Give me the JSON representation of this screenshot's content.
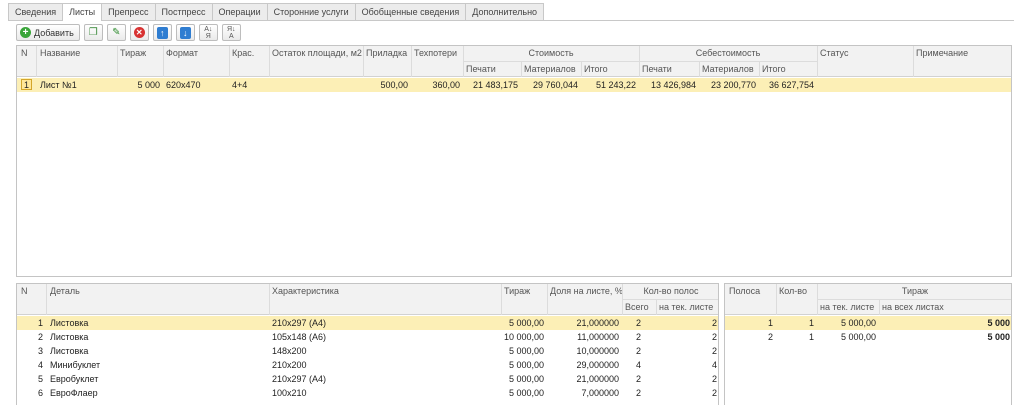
{
  "tabs": [
    {
      "label": "Сведения"
    },
    {
      "label": "Листы"
    },
    {
      "label": "Препресс"
    },
    {
      "label": "Постпресс"
    },
    {
      "label": "Операции"
    },
    {
      "label": "Сторонние услуги"
    },
    {
      "label": "Обобщенные сведения"
    },
    {
      "label": "Дополнительно"
    }
  ],
  "toolbar": {
    "add_label": "Добавить"
  },
  "sheets": {
    "headers": {
      "n": "N",
      "name": "Название",
      "tirazh": "Тираж",
      "format": "Формат",
      "kras": "Крас.",
      "ostatok": "Остаток площади, м2",
      "pripladka": "Приладка",
      "tekhpoteri": "Техпотери",
      "stoimost": "Стоимость",
      "sebestoimost": "Себестоимость",
      "pechati": "Печати",
      "materialov": "Материалов",
      "itogo": "Итого",
      "status": "Статус",
      "primechanie": "Примечание"
    },
    "rows": [
      {
        "n": "1",
        "name": "Лист №1",
        "tirazh": "5 000",
        "format": "620x470",
        "kras": "4+4",
        "ostatok": "",
        "pripladka": "500,00",
        "tekhpoteri": "360,00",
        "st_pechati": "21 483,175",
        "st_materialov": "29 760,044",
        "st_itogo": "51 243,22",
        "sb_pechati": "13 426,984",
        "sb_materialov": "23 200,770",
        "sb_itogo": "36 627,754",
        "status": "",
        "primechanie": ""
      }
    ]
  },
  "details": {
    "headers": {
      "n": "N",
      "detail": "Деталь",
      "kharakteristika": "Характеристика",
      "tirazh": "Тираж",
      "dolya": "Доля на листе, %",
      "kolvo_polos": "Кол-во полос",
      "vsego": "Всего",
      "na_tek": "на тек. листе"
    },
    "rows": [
      {
        "n": "1",
        "detail": "Листовка",
        "kharakteristika": "210x297 (А4)",
        "tirazh": "5 000,00",
        "dolya": "21,000000",
        "vsego": "2",
        "na_tek": "2"
      },
      {
        "n": "2",
        "detail": "Листовка",
        "kharakteristika": "105x148 (А6)",
        "tirazh": "10 000,00",
        "dolya": "11,000000",
        "vsego": "2",
        "na_tek": "2"
      },
      {
        "n": "3",
        "detail": "Листовка",
        "kharakteristika": "148x200",
        "tirazh": "5 000,00",
        "dolya": "10,000000",
        "vsego": "2",
        "na_tek": "2"
      },
      {
        "n": "4",
        "detail": "Минибуклет",
        "kharakteristika": "210x200",
        "tirazh": "5 000,00",
        "dolya": "29,000000",
        "vsego": "4",
        "na_tek": "4"
      },
      {
        "n": "5",
        "detail": "Евробуклет",
        "kharakteristika": "210x297 (А4)",
        "tirazh": "5 000,00",
        "dolya": "21,000000",
        "vsego": "2",
        "na_tek": "2"
      },
      {
        "n": "6",
        "detail": "ЕвроФлаер",
        "kharakteristika": "100x210",
        "tirazh": "5 000,00",
        "dolya": "7,000000",
        "vsego": "2",
        "na_tek": "2"
      }
    ]
  },
  "strips": {
    "headers": {
      "polosa": "Полоса",
      "kolvo": "Кол-во",
      "tirazh": "Тираж",
      "na_tek": "на тек. листе",
      "na_vseh": "на всех листах"
    },
    "rows": [
      {
        "polosa": "1",
        "kolvo": "1",
        "na_tek": "5 000,00",
        "na_vseh": "5 000"
      },
      {
        "polosa": "2",
        "kolvo": "1",
        "na_tek": "5 000,00",
        "na_vseh": "5 000"
      }
    ]
  }
}
